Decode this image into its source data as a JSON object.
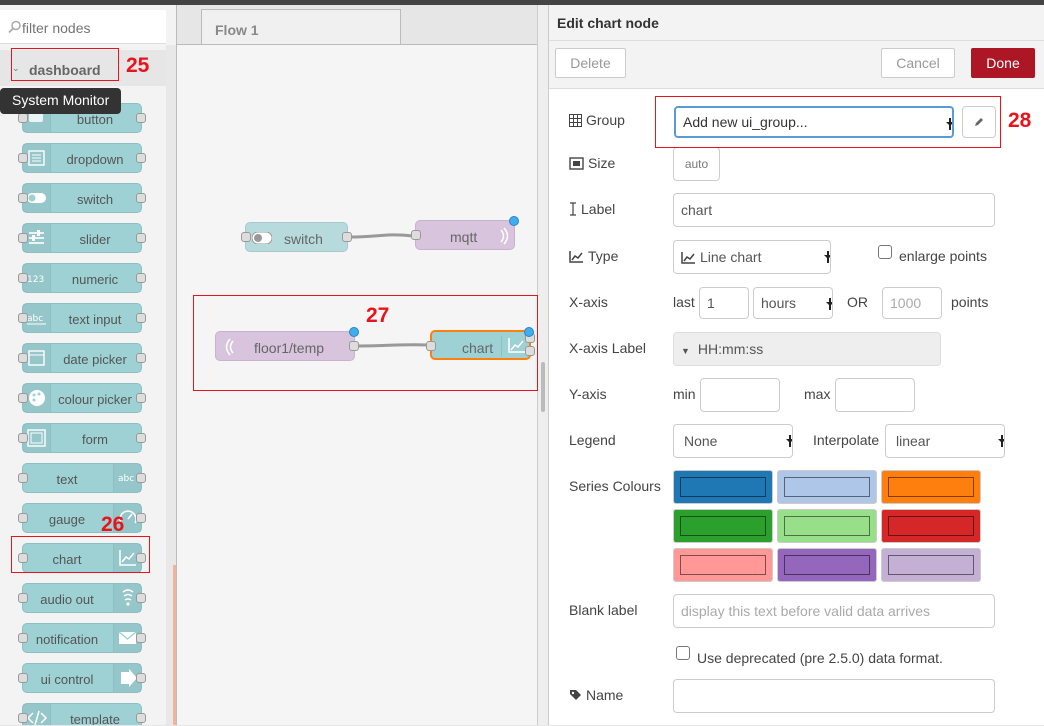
{
  "palette": {
    "search_placeholder": "filter nodes",
    "category": "dashboard",
    "tooltip": "System Monitor",
    "nodes": [
      {
        "label": "button",
        "icon": "button-icon",
        "side": "left"
      },
      {
        "label": "dropdown",
        "icon": "dropdown-icon",
        "side": "left"
      },
      {
        "label": "switch",
        "icon": "switch-icon",
        "side": "left"
      },
      {
        "label": "slider",
        "icon": "slider-icon",
        "side": "left"
      },
      {
        "label": "numeric",
        "icon": "numeric-icon",
        "side": "left"
      },
      {
        "label": "text input",
        "icon": "text-input-icon",
        "side": "left"
      },
      {
        "label": "date picker",
        "icon": "calendar-icon",
        "side": "left"
      },
      {
        "label": "colour picker",
        "icon": "palette-icon",
        "side": "left"
      },
      {
        "label": "form",
        "icon": "form-icon",
        "side": "left"
      },
      {
        "label": "text",
        "icon": "text-icon",
        "side": "right"
      },
      {
        "label": "gauge",
        "icon": "gauge-icon",
        "side": "right"
      },
      {
        "label": "chart",
        "icon": "chart-icon",
        "side": "right"
      },
      {
        "label": "audio out",
        "icon": "audio-icon",
        "side": "right"
      },
      {
        "label": "notification",
        "icon": "envelope-icon",
        "side": "right"
      },
      {
        "label": "ui control",
        "icon": "arrow-right-icon",
        "side": "right"
      },
      {
        "label": "template",
        "icon": "code-icon",
        "side": "left"
      }
    ]
  },
  "workspace": {
    "tab": "Flow 1",
    "nodes": [
      {
        "label": "switch"
      },
      {
        "label": "mqtt"
      },
      {
        "label": "floor1/temp"
      },
      {
        "label": "chart"
      }
    ]
  },
  "editor": {
    "title": "Edit chart node",
    "delete_label": "Delete",
    "cancel_label": "Cancel",
    "done_label": "Done",
    "group_label": "Group",
    "group_value": "Add new ui_group...",
    "size_label": "Size",
    "size_value": "auto",
    "label_label": "Label",
    "label_value": "chart",
    "type_label": "Type",
    "type_value": "Line chart",
    "enlarge_label": "enlarge points",
    "xaxis_label": "X-axis",
    "last_label": "last",
    "last_value": "1",
    "unit_value": "hours",
    "or_label": "OR",
    "points_placeholder": "1000",
    "points_label": "points",
    "xaxis_label_label": "X-axis Label",
    "xaxis_label_value": "HH:mm:ss",
    "yaxis_label": "Y-axis",
    "min_label": "min",
    "max_label": "max",
    "legend_label": "Legend",
    "legend_value": "None",
    "interpolate_label": "Interpolate",
    "interpolate_value": "linear",
    "series_label": "Series Colours",
    "series_colours": [
      "#1f77b4",
      "#aec7e8",
      "#ff7f0e",
      "#2ca02c",
      "#98df8a",
      "#d62728",
      "#ff9896",
      "#9467bd",
      "#c5b0d5"
    ],
    "blank_label": "Blank label",
    "blank_placeholder": "display this text before valid data arrives",
    "deprecated_label": "Use deprecated (pre 2.5.0) data format.",
    "name_label": "Name"
  },
  "annotations": {
    "n25": "25",
    "n26": "26",
    "n27": "27",
    "n28": "28"
  }
}
